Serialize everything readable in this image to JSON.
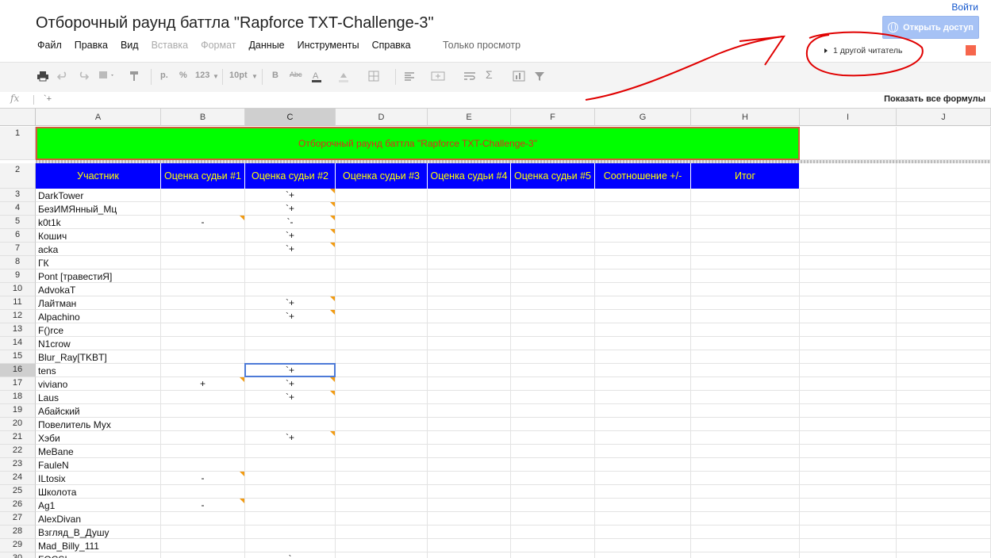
{
  "doc_title": "Отборочный раунд баттла \"Rapforce TXT-Challenge-3\"",
  "signin": "Войти",
  "share_button": "Открыть доступ",
  "menu": [
    {
      "label": "Файл",
      "enabled": true
    },
    {
      "label": "Правка",
      "enabled": true
    },
    {
      "label": "Вид",
      "enabled": true
    },
    {
      "label": "Вставка",
      "enabled": false
    },
    {
      "label": "Формат",
      "enabled": false
    },
    {
      "label": "Данные",
      "enabled": true
    },
    {
      "label": "Инструменты",
      "enabled": true
    },
    {
      "label": "Справка",
      "enabled": true
    }
  ],
  "view_only": "Только просмотр",
  "viewers": "1 другой читатель",
  "toolbar": {
    "currency": "р.",
    "percent": "%",
    "number_format": "123",
    "font_size": "10pt",
    "strike": "Abc"
  },
  "formula_bar": {
    "fx": "fx",
    "value": "`+",
    "show_all": "Показать все формулы"
  },
  "columns": [
    "A",
    "B",
    "C",
    "D",
    "E",
    "F",
    "G",
    "H",
    "I",
    "J"
  ],
  "selected_column": "C",
  "selected_row": 16,
  "title_cell": "Отборочный раунд баттла \"Rapforce TXT-Challenge-3\"",
  "header_row": [
    "Участник",
    "Оценка судьи #1",
    "Оценка судьи #2",
    "Оценка судьи #3",
    "Оценка судьи #4",
    "Оценка судьи #5",
    "Соотношение +/-",
    "Итог"
  ],
  "rows": [
    {
      "n": 3,
      "name": "DarkTower",
      "b": "",
      "c": "`+",
      "bnote": false,
      "cnote": true
    },
    {
      "n": 4,
      "name": "БезИМЯнный_Мц",
      "b": "",
      "c": "`+",
      "bnote": false,
      "cnote": true
    },
    {
      "n": 5,
      "name": "k0t1k",
      "b": "-",
      "c": "`-",
      "bnote": true,
      "cnote": true
    },
    {
      "n": 6,
      "name": "Кошич",
      "b": "",
      "c": "`+",
      "bnote": false,
      "cnote": true
    },
    {
      "n": 7,
      "name": "acka",
      "b": "",
      "c": "`+",
      "bnote": false,
      "cnote": true
    },
    {
      "n": 8,
      "name": "ГК",
      "b": "",
      "c": "",
      "bnote": false,
      "cnote": false
    },
    {
      "n": 9,
      "name": "Pont [травестиЯ]",
      "b": "",
      "c": "",
      "bnote": false,
      "cnote": false
    },
    {
      "n": 10,
      "name": "AdvokaT",
      "b": "",
      "c": "",
      "bnote": false,
      "cnote": false
    },
    {
      "n": 11,
      "name": "Лайтман",
      "b": "",
      "c": "`+",
      "bnote": false,
      "cnote": true
    },
    {
      "n": 12,
      "name": "Alpachino",
      "b": "",
      "c": "`+",
      "bnote": false,
      "cnote": true
    },
    {
      "n": 13,
      "name": "F()rce",
      "b": "",
      "c": "",
      "bnote": false,
      "cnote": false
    },
    {
      "n": 14,
      "name": "N1crow",
      "b": "",
      "c": "",
      "bnote": false,
      "cnote": false
    },
    {
      "n": 15,
      "name": "Blur_Ray[TKBT]",
      "b": "",
      "c": "",
      "bnote": false,
      "cnote": false
    },
    {
      "n": 16,
      "name": "tens",
      "b": "",
      "c": "`+",
      "bnote": false,
      "cnote": false
    },
    {
      "n": 17,
      "name": "viviano",
      "b": "+",
      "c": "`+",
      "bnote": true,
      "cnote": true
    },
    {
      "n": 18,
      "name": "Laus",
      "b": "",
      "c": "`+",
      "bnote": false,
      "cnote": true
    },
    {
      "n": 19,
      "name": "Абайский",
      "b": "",
      "c": "",
      "bnote": false,
      "cnote": false
    },
    {
      "n": 20,
      "name": "Повелитель Мух",
      "b": "",
      "c": "",
      "bnote": false,
      "cnote": false
    },
    {
      "n": 21,
      "name": "Хэби",
      "b": "",
      "c": "`+",
      "bnote": false,
      "cnote": true
    },
    {
      "n": 22,
      "name": "MeBane",
      "b": "",
      "c": "",
      "bnote": false,
      "cnote": false
    },
    {
      "n": 23,
      "name": "FauleN",
      "b": "",
      "c": "",
      "bnote": false,
      "cnote": false
    },
    {
      "n": 24,
      "name": "ILtosix",
      "b": "-",
      "c": "",
      "bnote": true,
      "cnote": false
    },
    {
      "n": 25,
      "name": "Школота",
      "b": "",
      "c": "",
      "bnote": false,
      "cnote": false
    },
    {
      "n": 26,
      "name": "Ag1",
      "b": "-",
      "c": "",
      "bnote": true,
      "cnote": false
    },
    {
      "n": 27,
      "name": "AlexDivan",
      "b": "",
      "c": "",
      "bnote": false,
      "cnote": false
    },
    {
      "n": 28,
      "name": "Взгляд_В_Душу",
      "b": "",
      "c": "",
      "bnote": false,
      "cnote": false
    },
    {
      "n": 29,
      "name": "Mad_Billy_111",
      "b": "",
      "c": "",
      "bnote": false,
      "cnote": false
    },
    {
      "n": 30,
      "name": "FOCSI",
      "b": "",
      "c": "`",
      "bnote": false,
      "cnote": false
    }
  ],
  "colors": {
    "title_bg": "#00ff00",
    "title_text": "#e02a1c",
    "header_bg": "#0000ff",
    "header_text": "#ffff00",
    "note": "#f29b12",
    "selection": "#4d7ad7",
    "annotation": "#e00000"
  }
}
